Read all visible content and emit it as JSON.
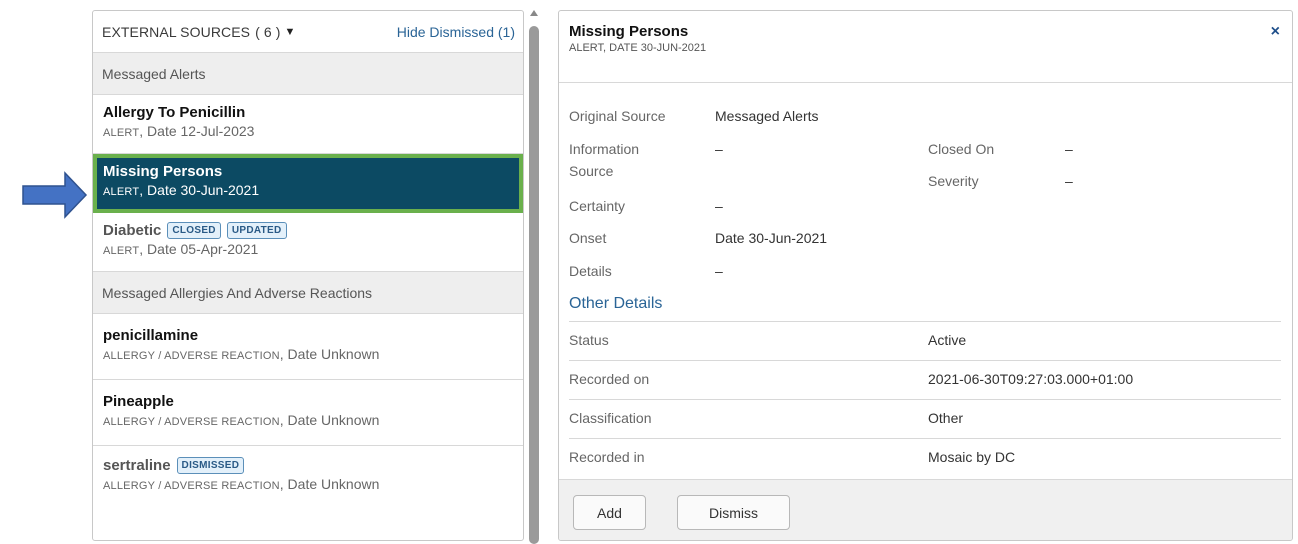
{
  "left": {
    "header_title": "EXTERNAL SOURCES",
    "header_count": "( 6 )",
    "hide_link": "Hide Dismissed (1)",
    "groups": [
      {
        "label": "Messaged Alerts",
        "items": [
          {
            "title": "Allergy To Penicillin",
            "kind": "ALERT",
            "date": ", Date 12-Jul-2023"
          },
          {
            "title": "Missing Persons",
            "kind": "ALERT",
            "date": ", Date 30-Jun-2021"
          },
          {
            "title": "Diabetic",
            "kind": "ALERT",
            "date": ", Date 05-Apr-2021",
            "badges": [
              "CLOSED",
              "UPDATED"
            ]
          }
        ]
      },
      {
        "label": "Messaged Allergies And Adverse Reactions",
        "items": [
          {
            "title": "penicillamine",
            "kind": "ALLERGY / ADVERSE REACTION",
            "date": ", Date Unknown"
          },
          {
            "title": "Pineapple",
            "kind": "ALLERGY / ADVERSE REACTION",
            "date": ", Date Unknown"
          },
          {
            "title": "sertraline",
            "kind": "ALLERGY / ADVERSE REACTION",
            "date": ", Date Unknown",
            "badges": [
              "DISMISSED"
            ]
          }
        ]
      }
    ]
  },
  "right": {
    "title": "Missing Persons",
    "subtitle": "ALERT, DATE 30-JUN-2021",
    "close_icon": "×",
    "fields": {
      "original_source_label": "Original Source",
      "original_source_value": "Messaged Alerts",
      "information_source_label_1": "Information",
      "information_source_label_2": "Source",
      "information_source_value": "–",
      "closed_on_label": "Closed On",
      "closed_on_value": "–",
      "severity_label": "Severity",
      "severity_value": "–",
      "certainty_label": "Certainty",
      "certainty_value": "–",
      "onset_label": "Onset",
      "onset_value": "Date 30-Jun-2021",
      "details_label": "Details",
      "details_value": "–"
    },
    "other_details_title": "Other Details",
    "other_details": [
      {
        "label": "Status",
        "value": "Active"
      },
      {
        "label": "Recorded on",
        "value": "2021-06-30T09:27:03.000+01:00"
      },
      {
        "label": "Classification",
        "value": "Other"
      },
      {
        "label": "Recorded in",
        "value": "Mosaic by DC"
      }
    ],
    "buttons": {
      "add": "Add",
      "dismiss": "Dismiss"
    }
  },
  "colors": {
    "selected_bg": "#0c4a63",
    "selected_outline": "#6ab04c",
    "link": "#2a6496",
    "arrow": "#4472c4"
  },
  "icons": {
    "caret": "caret-down-icon",
    "close": "close-icon",
    "arrow": "pointer-arrow-icon"
  }
}
